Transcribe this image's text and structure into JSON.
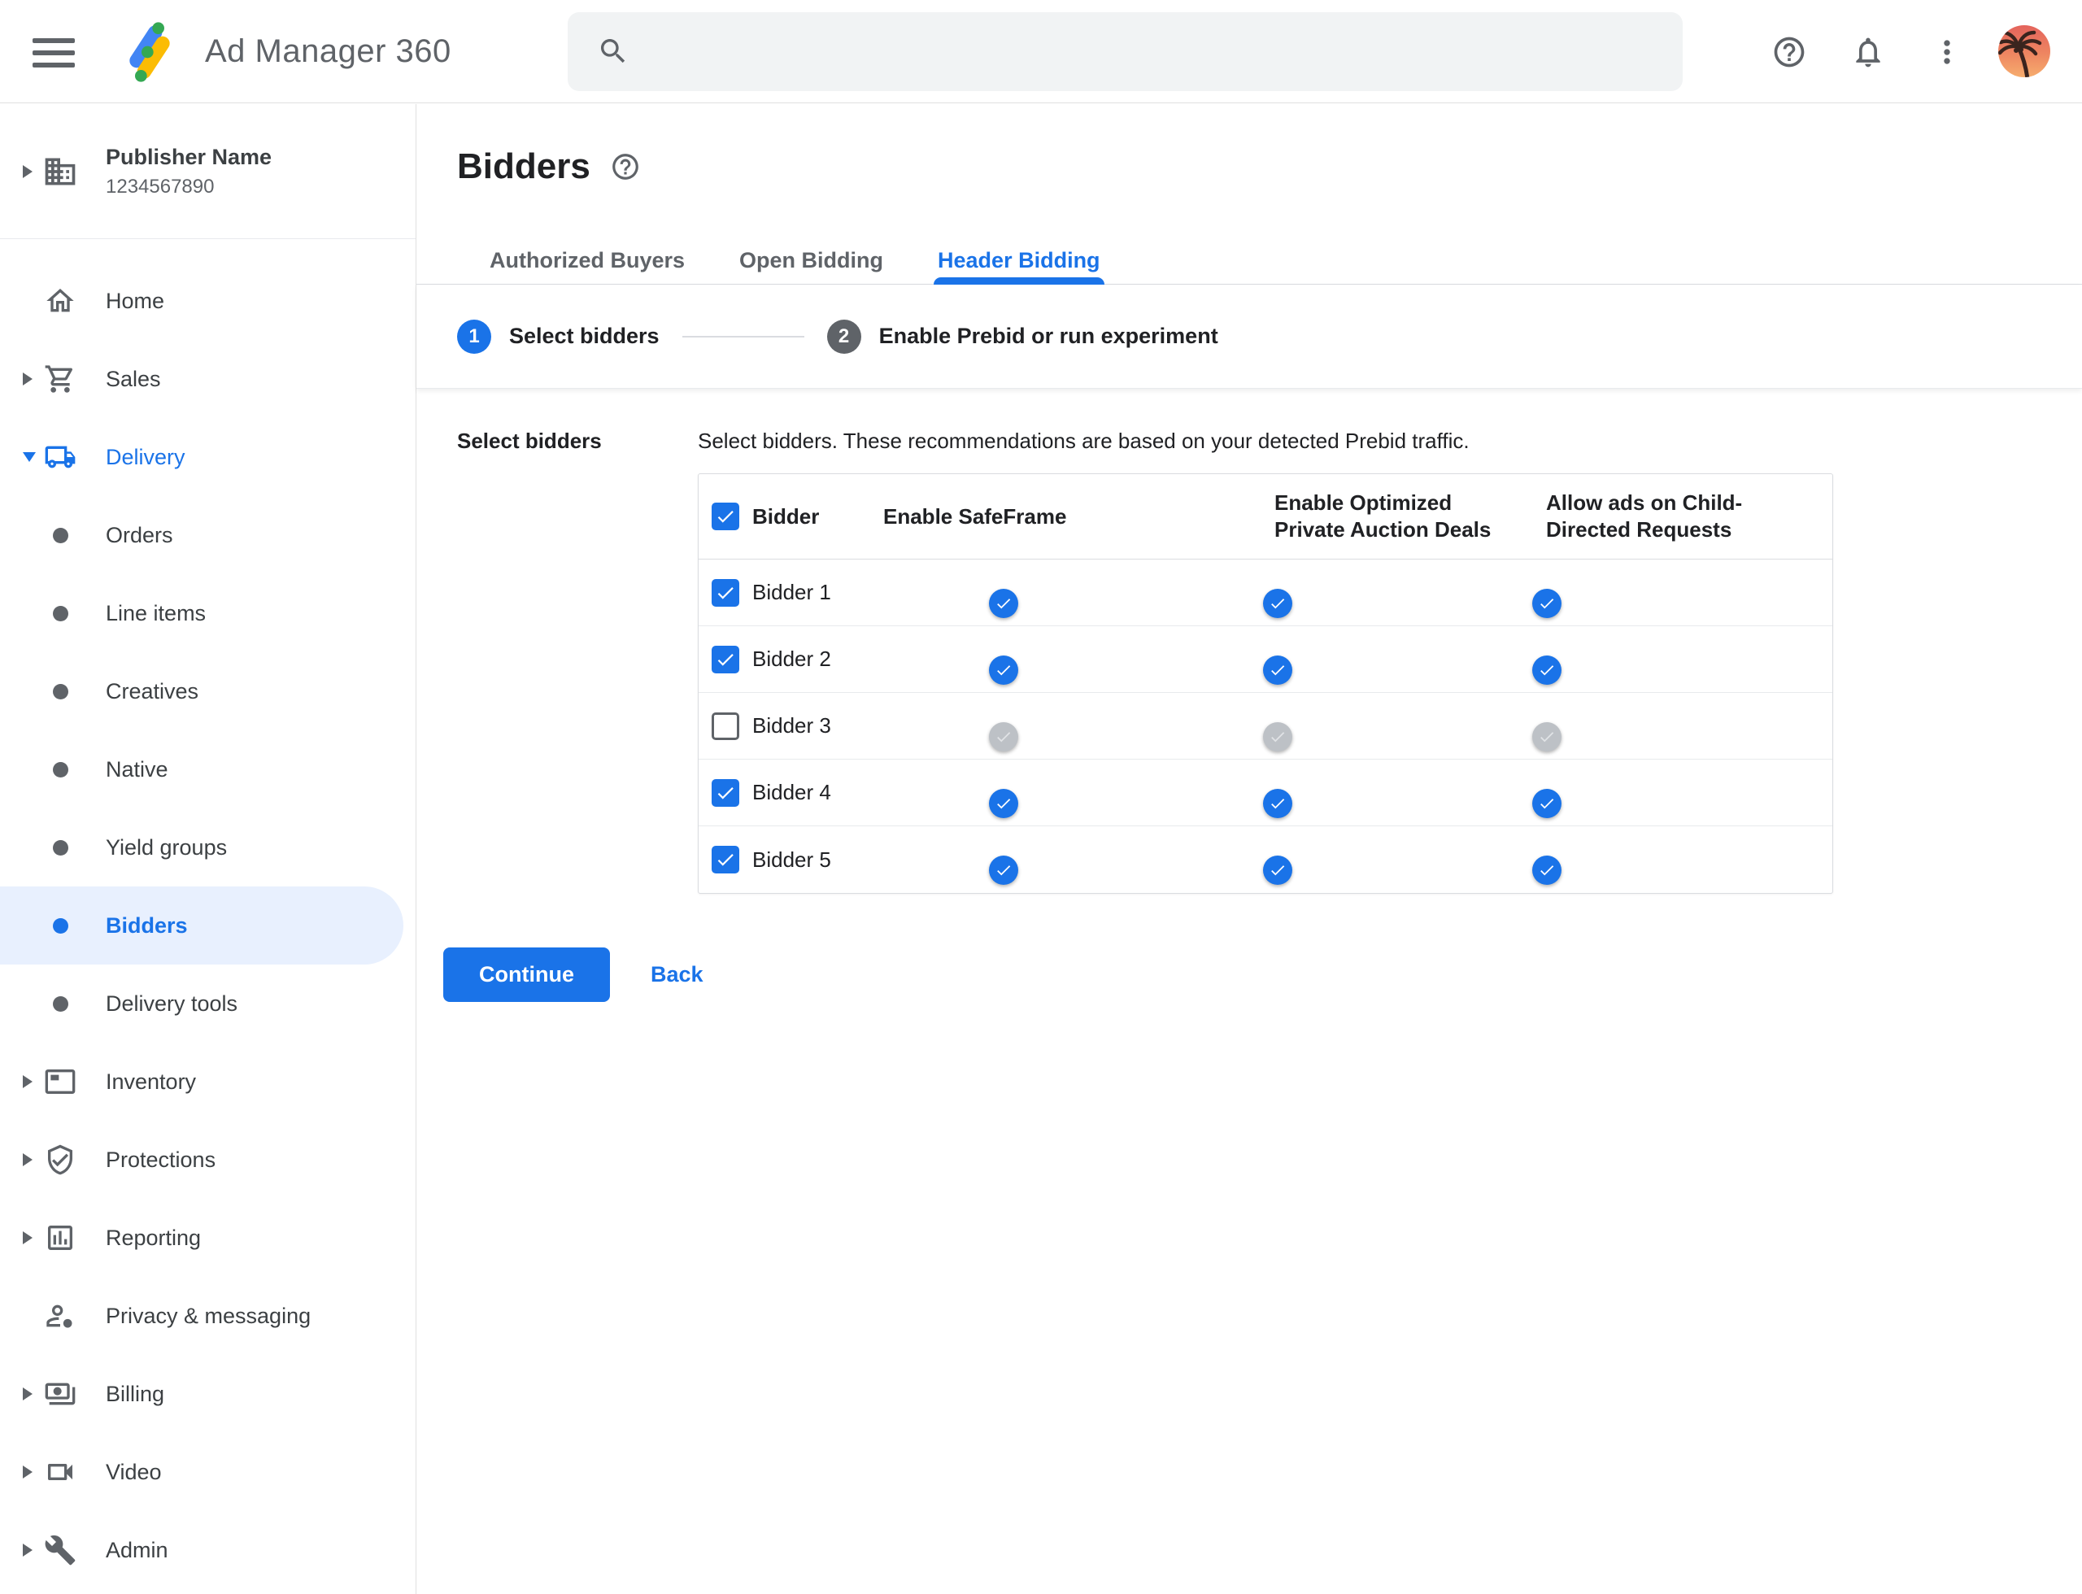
{
  "appbar": {
    "product_name": "Ad Manager 360",
    "search": {
      "value": ""
    },
    "icons": {
      "menu": "hamburger-menu",
      "logo": "ad-manager-logo",
      "search": "magnifier",
      "help": "question-circle",
      "notifications": "bell",
      "more": "vertical-dots",
      "account": "palm-tree-avatar"
    }
  },
  "sidebar": {
    "publisher": {
      "name": "Publisher Name",
      "id": "1234567890",
      "icon": "building"
    },
    "items": [
      {
        "label": "Home",
        "icon": "home",
        "indent": 0,
        "expandable": false
      },
      {
        "label": "Sales",
        "icon": "cart",
        "indent": 0,
        "expandable": true
      },
      {
        "label": "Delivery",
        "icon": "truck",
        "indent": 0,
        "expandable": true,
        "expanded": true
      },
      {
        "label": "Orders",
        "icon": "dot",
        "indent": 1
      },
      {
        "label": "Line items",
        "icon": "dot",
        "indent": 1
      },
      {
        "label": "Creatives",
        "icon": "dot",
        "indent": 1
      },
      {
        "label": "Native",
        "icon": "dot",
        "indent": 1
      },
      {
        "label": "Yield groups",
        "icon": "dot",
        "indent": 1
      },
      {
        "label": "Bidders",
        "icon": "dot",
        "indent": 1,
        "selected": true
      },
      {
        "label": "Delivery tools",
        "icon": "dot",
        "indent": 1
      },
      {
        "label": "Inventory",
        "icon": "ad-unit",
        "indent": 0,
        "expandable": true
      },
      {
        "label": "Protections",
        "icon": "shield-check",
        "indent": 0,
        "expandable": true
      },
      {
        "label": "Reporting",
        "icon": "bar-chart",
        "indent": 0,
        "expandable": true
      },
      {
        "label": "Privacy & messaging",
        "icon": "person-badge",
        "indent": 0,
        "expandable": false
      },
      {
        "label": "Billing",
        "icon": "payments",
        "indent": 0,
        "expandable": true
      },
      {
        "label": "Video",
        "icon": "videocam",
        "indent": 0,
        "expandable": true
      },
      {
        "label": "Admin",
        "icon": "wrench",
        "indent": 0,
        "expandable": true
      }
    ]
  },
  "main": {
    "title": "Bidders",
    "tabs": [
      {
        "label": "Authorized Buyers",
        "active": false
      },
      {
        "label": "Open Bidding",
        "active": false
      },
      {
        "label": "Header Bidding",
        "active": true
      }
    ],
    "stepper": {
      "steps": [
        {
          "number": "1",
          "label": "Select bidders",
          "state": "active"
        },
        {
          "number": "2",
          "label": "Enable Prebid or run experiment",
          "state": "upcoming"
        }
      ]
    },
    "form": {
      "section_label": "Select bidders",
      "description": "Select bidders. These recommendations are based on your detected Prebid traffic.",
      "table": {
        "select_all_checked": true,
        "columns": [
          "Bidder",
          "Enable SafeFrame",
          "Enable Optimized Private Auction Deals",
          "Allow ads on Child-Directed Requests"
        ],
        "rows": [
          {
            "name": "Bidder 1",
            "selected": true,
            "enable_safeframe": true,
            "enable_optimized_private_auction_deals": true,
            "allow_ads_child_directed": true
          },
          {
            "name": "Bidder 2",
            "selected": true,
            "enable_safeframe": true,
            "enable_optimized_private_auction_deals": true,
            "allow_ads_child_directed": true
          },
          {
            "name": "Bidder 3",
            "selected": false,
            "enable_safeframe": false,
            "enable_optimized_private_auction_deals": false,
            "allow_ads_child_directed": false
          },
          {
            "name": "Bidder 4",
            "selected": true,
            "enable_safeframe": true,
            "enable_optimized_private_auction_deals": true,
            "allow_ads_child_directed": true
          },
          {
            "name": "Bidder 5",
            "selected": true,
            "enable_safeframe": true,
            "enable_optimized_private_auction_deals": true,
            "allow_ads_child_directed": true
          }
        ]
      },
      "buttons": {
        "continue": "Continue",
        "back": "Back"
      }
    }
  },
  "colors": {
    "accent": "#1a73e8",
    "selected_pill": "#e8f0fe",
    "toggle_track_on": "#8ab4f8",
    "toggle_disabled_knob": "#bdc1c6",
    "text_primary": "#202124",
    "text_secondary": "#5f6368"
  }
}
